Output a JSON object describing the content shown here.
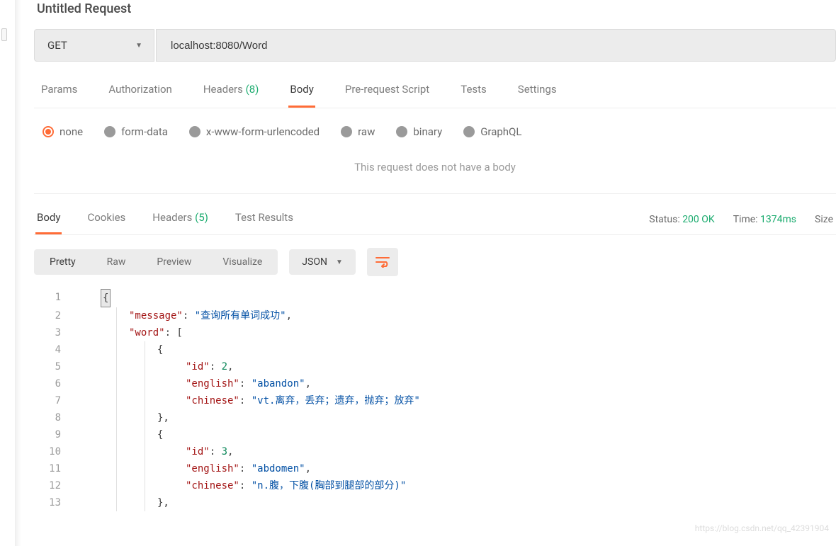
{
  "title": "Untitled Request",
  "request": {
    "method": "GET",
    "url": "localhost:8080/Word"
  },
  "tabs": {
    "params": "Params",
    "authorization": "Authorization",
    "headers": "Headers",
    "headers_count": "(8)",
    "body": "Body",
    "prescript": "Pre-request Script",
    "tests": "Tests",
    "settings": "Settings"
  },
  "body_types": {
    "none": "none",
    "formdata": "form-data",
    "urlencoded": "x-www-form-urlencoded",
    "raw": "raw",
    "binary": "binary",
    "graphql": "GraphQL"
  },
  "no_body_text": "This request does not have a body",
  "resp_tabs": {
    "body": "Body",
    "cookies": "Cookies",
    "headers": "Headers",
    "headers_count": "(5)",
    "tests": "Test Results"
  },
  "status": {
    "label": "Status:",
    "value": "200 OK",
    "time_label": "Time:",
    "time_value": "1374ms",
    "size_label": "Size"
  },
  "view_tabs": {
    "pretty": "Pretty",
    "raw": "Raw",
    "preview": "Preview",
    "visualize": "Visualize"
  },
  "format_select": "JSON",
  "json": [
    {
      "ln": 1,
      "indent": 0,
      "tokens": [
        {
          "t": "cursor",
          "v": "{"
        }
      ]
    },
    {
      "ln": 2,
      "indent": 1,
      "tokens": [
        {
          "t": "k",
          "v": "\"message\""
        },
        {
          "t": "p",
          "v": ": "
        },
        {
          "t": "s",
          "v": "\"查询所有单词成功\""
        },
        {
          "t": "p",
          "v": ","
        }
      ]
    },
    {
      "ln": 3,
      "indent": 1,
      "tokens": [
        {
          "t": "k",
          "v": "\"word\""
        },
        {
          "t": "p",
          "v": ": ["
        }
      ]
    },
    {
      "ln": 4,
      "indent": 2,
      "tokens": [
        {
          "t": "p",
          "v": "{"
        }
      ]
    },
    {
      "ln": 5,
      "indent": 3,
      "tokens": [
        {
          "t": "k",
          "v": "\"id\""
        },
        {
          "t": "p",
          "v": ": "
        },
        {
          "t": "n",
          "v": "2"
        },
        {
          "t": "p",
          "v": ","
        }
      ]
    },
    {
      "ln": 6,
      "indent": 3,
      "tokens": [
        {
          "t": "k",
          "v": "\"english\""
        },
        {
          "t": "p",
          "v": ": "
        },
        {
          "t": "s",
          "v": "\"abandon\""
        },
        {
          "t": "p",
          "v": ","
        }
      ]
    },
    {
      "ln": 7,
      "indent": 3,
      "tokens": [
        {
          "t": "k",
          "v": "\"chinese\""
        },
        {
          "t": "p",
          "v": ": "
        },
        {
          "t": "s",
          "v": "\"vt.离弃，丢弃；遗弃，抛弃；放弃\""
        }
      ]
    },
    {
      "ln": 8,
      "indent": 2,
      "tokens": [
        {
          "t": "p",
          "v": "},"
        }
      ]
    },
    {
      "ln": 9,
      "indent": 2,
      "tokens": [
        {
          "t": "p",
          "v": "{"
        }
      ]
    },
    {
      "ln": 10,
      "indent": 3,
      "tokens": [
        {
          "t": "k",
          "v": "\"id\""
        },
        {
          "t": "p",
          "v": ": "
        },
        {
          "t": "n",
          "v": "3"
        },
        {
          "t": "p",
          "v": ","
        }
      ]
    },
    {
      "ln": 11,
      "indent": 3,
      "tokens": [
        {
          "t": "k",
          "v": "\"english\""
        },
        {
          "t": "p",
          "v": ": "
        },
        {
          "t": "s",
          "v": "\"abdomen\""
        },
        {
          "t": "p",
          "v": ","
        }
      ]
    },
    {
      "ln": 12,
      "indent": 3,
      "tokens": [
        {
          "t": "k",
          "v": "\"chinese\""
        },
        {
          "t": "p",
          "v": ": "
        },
        {
          "t": "s",
          "v": "\"n.腹，下腹(胸部到腿部的部分)\""
        }
      ]
    },
    {
      "ln": 13,
      "indent": 2,
      "tokens": [
        {
          "t": "p",
          "v": "},"
        }
      ]
    }
  ],
  "watermark": "https://blog.csdn.net/qq_42391904"
}
